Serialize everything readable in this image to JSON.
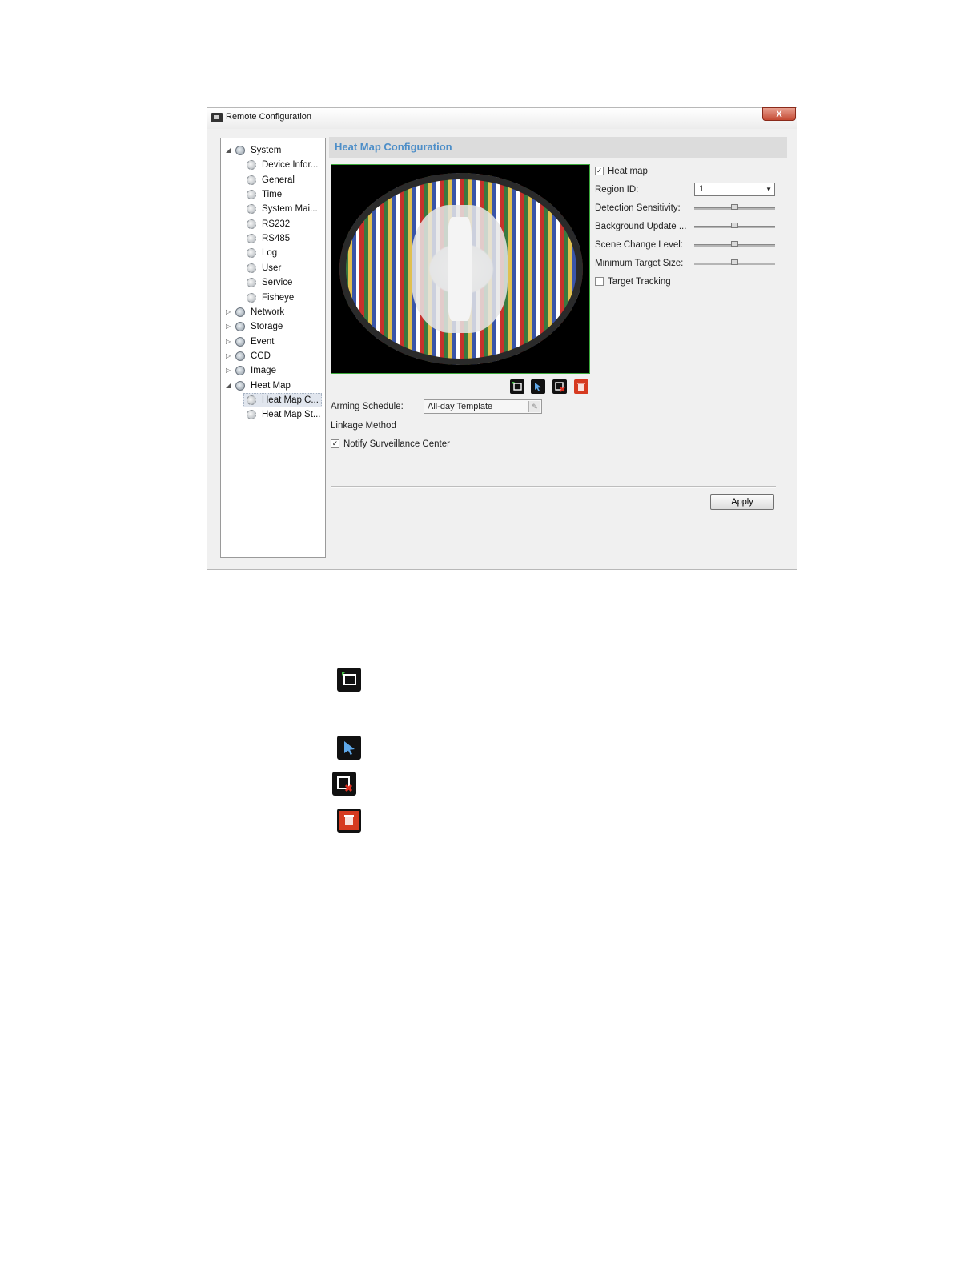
{
  "window": {
    "title": "Remote Configuration",
    "close_label": "X"
  },
  "tree": [
    {
      "label": "System",
      "level": 0,
      "arrow": "◢"
    },
    {
      "label": "Device Infor...",
      "level": 1
    },
    {
      "label": "General",
      "level": 1
    },
    {
      "label": "Time",
      "level": 1
    },
    {
      "label": "System Mai...",
      "level": 1
    },
    {
      "label": "RS232",
      "level": 1
    },
    {
      "label": "RS485",
      "level": 1
    },
    {
      "label": "Log",
      "level": 1
    },
    {
      "label": "User",
      "level": 1
    },
    {
      "label": "Service",
      "level": 1
    },
    {
      "label": "Fisheye",
      "level": 1
    },
    {
      "label": "Network",
      "level": 0,
      "arrow": "▷"
    },
    {
      "label": "Storage",
      "level": 0,
      "arrow": "▷"
    },
    {
      "label": "Event",
      "level": 0,
      "arrow": "▷"
    },
    {
      "label": "CCD",
      "level": 0,
      "arrow": "▷"
    },
    {
      "label": "Image",
      "level": 0,
      "arrow": "▷"
    },
    {
      "label": "Heat Map",
      "level": 0,
      "arrow": "◢"
    },
    {
      "label": "Heat Map C...",
      "level": 1,
      "selected": true
    },
    {
      "label": "Heat Map St...",
      "level": 1
    }
  ],
  "content": {
    "title": "Heat Map Configuration",
    "heat_map_checkbox": {
      "label": "Heat map",
      "checked": true
    },
    "region_id": {
      "label": "Region ID:",
      "value": "1"
    },
    "detection_sensitivity": {
      "label": "Detection Sensitivity:",
      "level": 0.5
    },
    "background_update": {
      "label": "Background Update ...",
      "level": 0.5
    },
    "scene_change_level": {
      "label": "Scene Change Level:",
      "level": 0.5
    },
    "minimum_target_size": {
      "label": "Minimum Target Size:",
      "level": 0.5
    },
    "target_tracking": {
      "label": "Target Tracking",
      "checked": false
    },
    "arming_schedule": {
      "label": "Arming Schedule:",
      "value": "All-day Template"
    },
    "linkage_method": {
      "label": "Linkage Method"
    },
    "notify_center": {
      "label": "Notify Surveillance Center",
      "checked": true
    },
    "apply_label": "Apply"
  },
  "toolbar_icons": [
    "draw-area-icon",
    "select-pointer-icon",
    "clear-area-icon",
    "delete-icon"
  ],
  "colors": {
    "title_accent": "#4d8ec8",
    "video_border": "#3aa83a",
    "delete_red": "#d63a20"
  }
}
